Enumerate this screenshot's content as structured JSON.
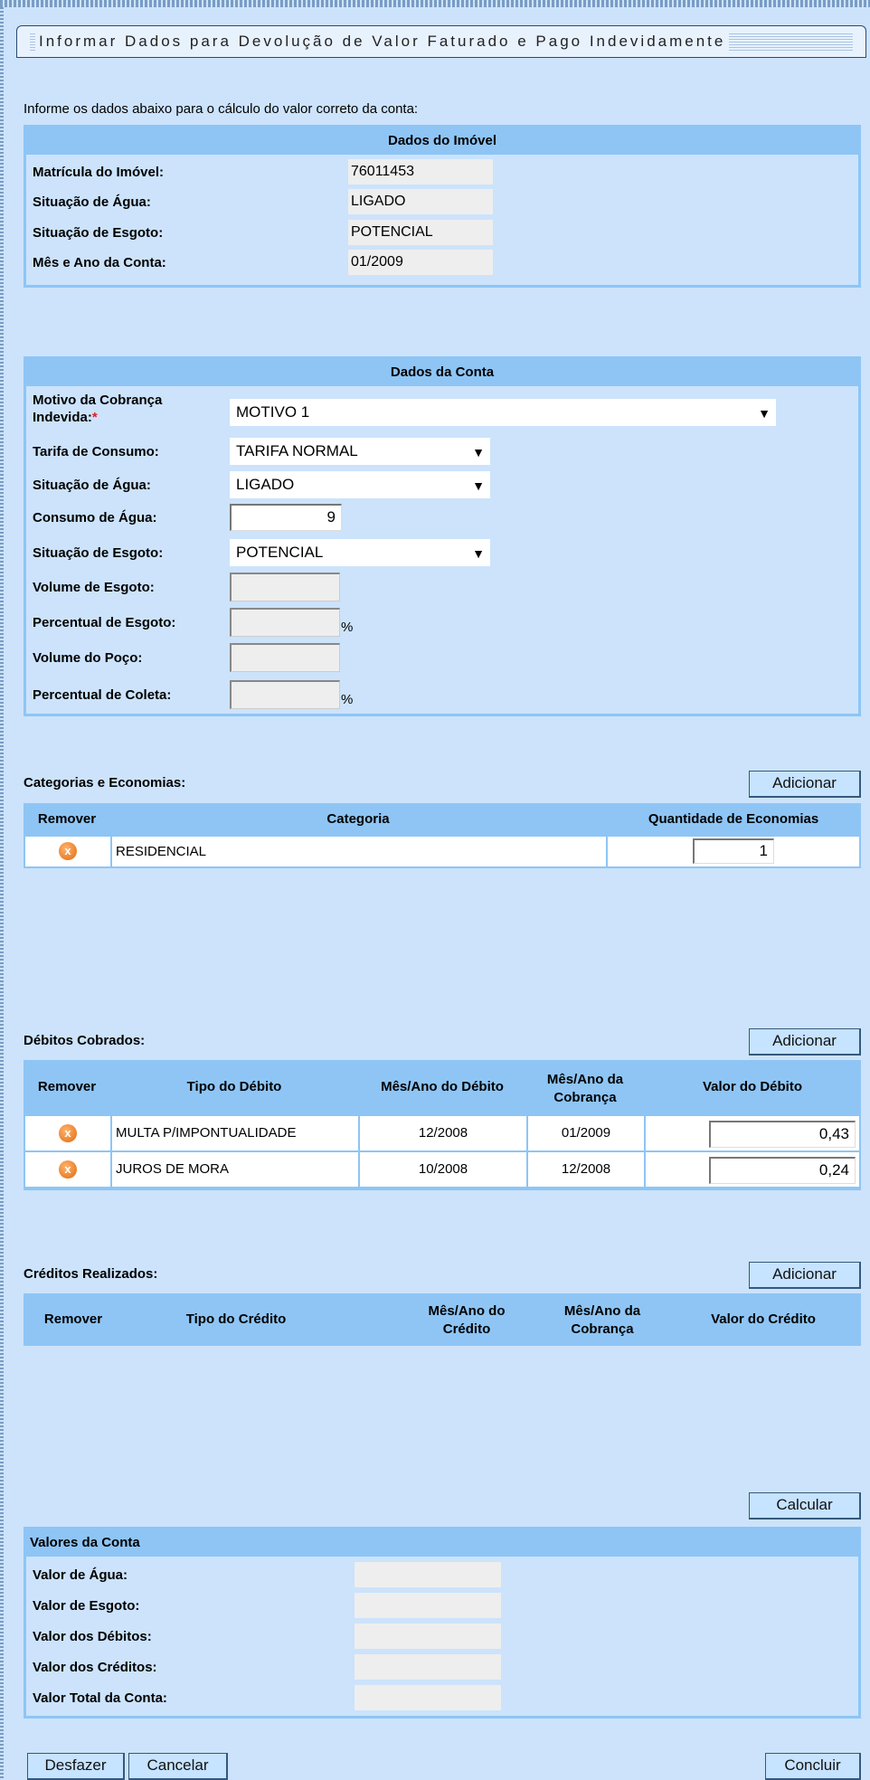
{
  "title": "Informar Dados para Devolução de Valor Faturado e Pago Indevidamente",
  "instructions": "Informe os dados abaixo para o cálculo do valor correto da conta:",
  "imovel": {
    "header": "Dados do Imóvel",
    "rows": [
      {
        "label": "Matrícula do Imóvel:",
        "value": "76011453"
      },
      {
        "label": "Situação de Água:",
        "value": "LIGADO"
      },
      {
        "label": "Situação de Esgoto:",
        "value": "POTENCIAL"
      },
      {
        "label": "Mês e Ano da Conta:",
        "value": "01/2009"
      }
    ]
  },
  "conta": {
    "header": "Dados da Conta",
    "motivo_label": "Motivo da Cobrança Indevida:",
    "required_mark": "*",
    "motivo_value": "MOTIVO 1",
    "tarifa_label": "Tarifa de Consumo:",
    "tarifa_value": "TARIFA NORMAL",
    "sit_agua_label": "Situação de Água:",
    "sit_agua_value": "LIGADO",
    "consumo_label": "Consumo de Água:",
    "consumo_value": "9",
    "sit_esgoto_label": "Situação de Esgoto:",
    "sit_esgoto_value": "POTENCIAL",
    "vol_esgoto_label": "Volume de Esgoto:",
    "perc_esgoto_label": "Percentual de Esgoto:",
    "vol_poco_label": "Volume do Poço:",
    "perc_coleta_label": "Percentual de Coleta:",
    "percent_sign": "%",
    "dropdown_arrow": "▼"
  },
  "categorias": {
    "label": "Categorias e Economias:",
    "add_label": "Adicionar",
    "col_remover": "Remover",
    "col_categoria": "Categoria",
    "col_quantidade": "Quantidade de Economias",
    "rows": [
      {
        "categoria": "RESIDENCIAL",
        "quantidade": "1"
      }
    ]
  },
  "debitos": {
    "label": "Débitos Cobrados:",
    "add_label": "Adicionar",
    "col_remover": "Remover",
    "col_tipo": "Tipo do Débito",
    "col_mes_debito": "Mês/Ano do Débito",
    "col_mes_cobranca": "Mês/Ano da Cobrança",
    "col_valor": "Valor do Débito",
    "rows": [
      {
        "tipo": "MULTA P/IMPONTUALIDADE",
        "mes_debito": "12/2008",
        "mes_cobranca": "01/2009",
        "valor": "0,43"
      },
      {
        "tipo": "JUROS DE MORA",
        "mes_debito": "10/2008",
        "mes_cobranca": "12/2008",
        "valor": "0,24"
      }
    ]
  },
  "creditos": {
    "label": "Créditos Realizados:",
    "add_label": "Adicionar",
    "col_remover": "Remover",
    "col_tipo": "Tipo do Crédito",
    "col_mes_credito": "Mês/Ano do Crédito",
    "col_mes_cobranca": "Mês/Ano da Cobrança",
    "col_valor": "Valor do Crédito"
  },
  "calcular_label": "Calcular",
  "valores": {
    "header": "Valores da Conta",
    "rows": [
      {
        "label": "Valor de Água:"
      },
      {
        "label": "Valor de Esgoto:"
      },
      {
        "label": "Valor dos Débitos:"
      },
      {
        "label": "Valor dos Créditos:"
      },
      {
        "label": "Valor Total da Conta:"
      }
    ]
  },
  "remove_icon_glyph": "x",
  "buttons": {
    "desfazer": "Desfazer",
    "cancelar": "Cancelar",
    "concluir": "Concluir"
  }
}
